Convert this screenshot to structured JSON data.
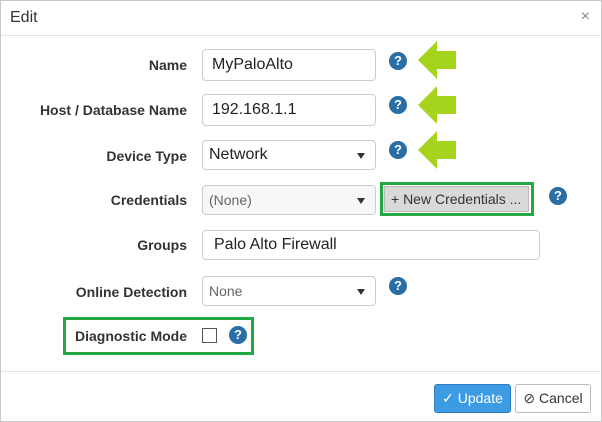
{
  "dialog": {
    "title": "Edit",
    "close_glyph": "×"
  },
  "form": {
    "name": {
      "label": "Name",
      "value": "MyPaloAlto"
    },
    "host": {
      "label": "Host / Database Name",
      "value": "192.168.1.1"
    },
    "device_type": {
      "label": "Device Type",
      "selected": "Network"
    },
    "credentials": {
      "label": "Credentials",
      "selected": "(None)",
      "new_button": "+ New Credentials ..."
    },
    "groups": {
      "label": "Groups",
      "value": "Palo Alto Firewall"
    },
    "online_detection": {
      "label": "Online Detection",
      "selected": "None"
    },
    "diagnostic_mode": {
      "label": "Diagnostic Mode",
      "checked": false
    }
  },
  "help_glyph": "?",
  "footer": {
    "update_label": "Update",
    "cancel_label": "Cancel"
  },
  "colors": {
    "highlight_green": "#22a844",
    "arrow_lime": "#a6d31c",
    "help_blue": "#2a6ea6",
    "primary_blue": "#3c9be2"
  },
  "icons": {
    "help": "question-circle-icon",
    "arrow": "left-arrow-icon",
    "check": "check-icon",
    "cancel": "ban-icon",
    "close": "close-icon",
    "caret": "caret-down-icon"
  }
}
